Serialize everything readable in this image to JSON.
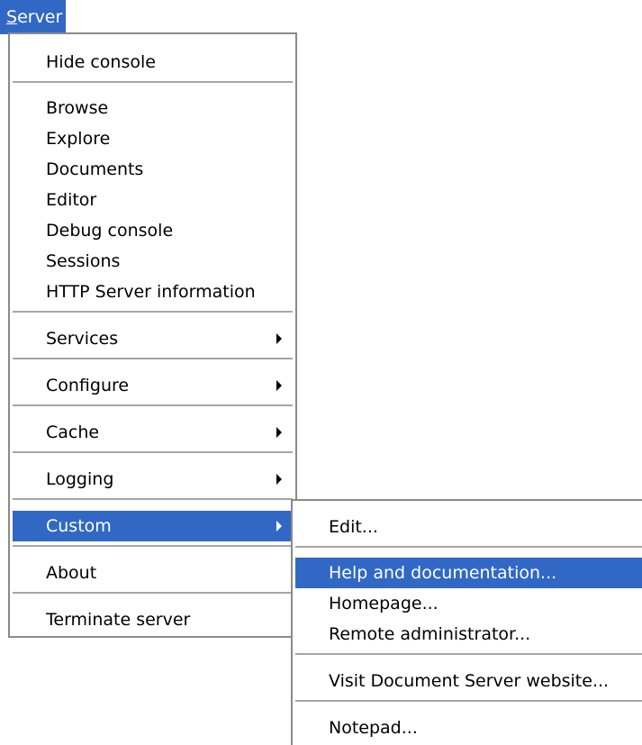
{
  "menubar": {
    "title_underlined": "S",
    "title_rest": "erver"
  },
  "main_menu": {
    "hide_console": "Hide console",
    "browse": "Browse",
    "explore": "Explore",
    "documents": "Documents",
    "editor": "Editor",
    "debug_console": "Debug console",
    "sessions": "Sessions",
    "http_info": "HTTP Server information",
    "services": "Services",
    "configure": "Configure",
    "cache": "Cache",
    "logging": "Logging",
    "custom": "Custom",
    "about": "About",
    "terminate": "Terminate server"
  },
  "custom_submenu": {
    "edit": "Edit...",
    "help": "Help and documentation...",
    "homepage": "Homepage...",
    "remote_admin": "Remote administrator...",
    "visit_website": "Visit Document Server website...",
    "notepad": "Notepad..."
  },
  "highlight_color": "#3168c5"
}
